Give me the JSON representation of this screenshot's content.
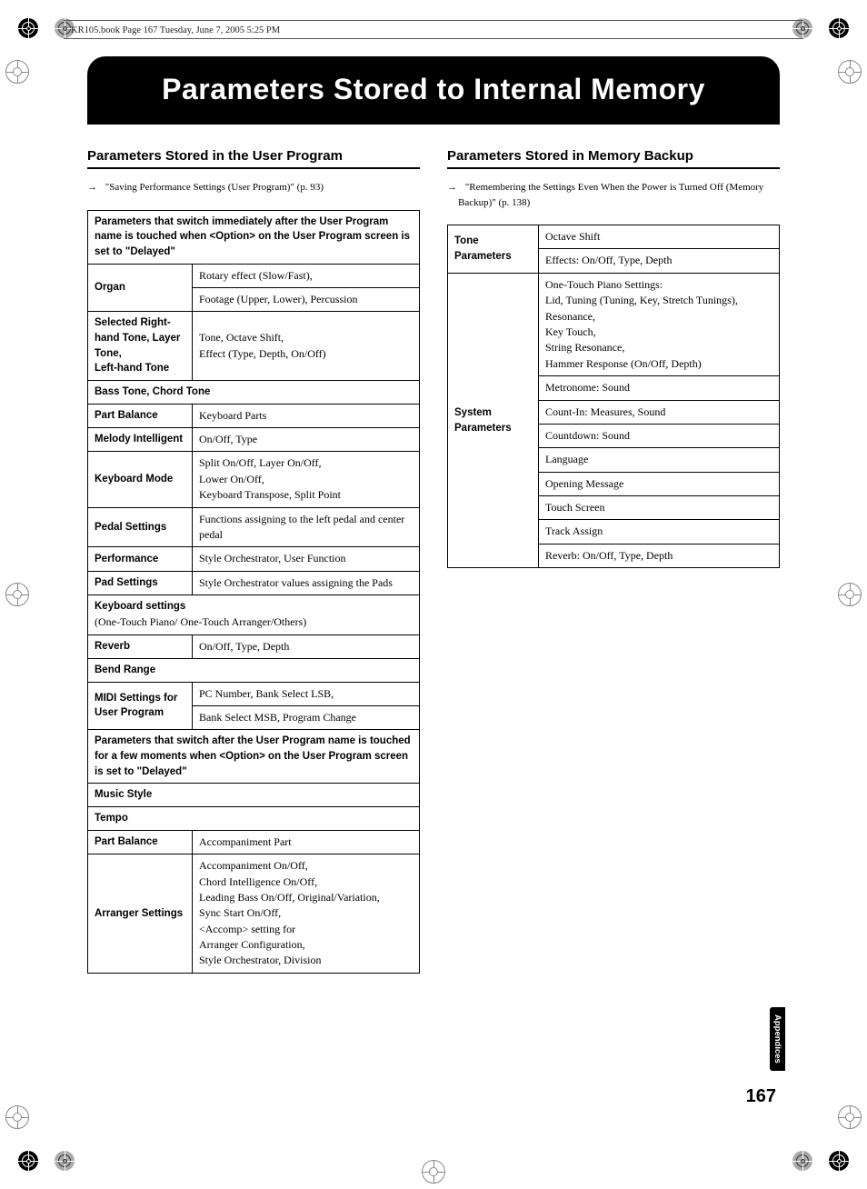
{
  "header_line": "KR105.book  Page 167  Tuesday, June 7, 2005  5:25 PM",
  "title": "Parameters Stored to Internal Memory",
  "left": {
    "heading": "Parameters Stored in the User Program",
    "ref_arrow": "→",
    "ref": "\"Saving Performance Settings (User Program)\" (p. 93)",
    "section1_header": "Parameters that switch immediately after the User Program name is touched when <Option> on the User Program screen is set to \"Delayed\"",
    "rows1": [
      {
        "label": "Organ",
        "value": "Rotary effect (Slow/Fast),\nFootage (Upper, Lower), Percussion",
        "split": true
      },
      {
        "label": "Selected Right-hand Tone, Layer Tone,\nLeft-hand Tone",
        "value": "Tone, Octave Shift,\nEffect (Type, Depth, On/Off)"
      },
      {
        "full": "Bass Tone, Chord Tone"
      },
      {
        "label": "Part Balance",
        "value": "Keyboard Parts"
      },
      {
        "label": "Melody Intelligent",
        "value": "On/Off, Type"
      },
      {
        "label": "Keyboard Mode",
        "value": "Split On/Off, Layer On/Off,\nLower On/Off,\nKeyboard Transpose, Split Point"
      },
      {
        "label": "Pedal Settings",
        "value": "Functions assigning to the left pedal and center pedal"
      },
      {
        "label": "Performance",
        "value": "Style Orchestrator, User Function"
      },
      {
        "label": "Pad Settings",
        "value": "Style Orchestrator values assigning the Pads"
      },
      {
        "full": "Keyboard settings",
        "subnote": "(One-Touch Piano/ One-Touch Arranger/Others)"
      },
      {
        "label": "Reverb",
        "value": "On/Off, Type, Depth"
      },
      {
        "full": "Bend Range"
      },
      {
        "label": "MIDI Settings for User Program",
        "value": "PC Number, Bank Select LSB,\nBank Select MSB, Program Change",
        "split": true
      }
    ],
    "section2_header": "Parameters that switch after the User Program name is touched for a few moments when <Option> on the User Program screen is set to \"Delayed\"",
    "rows2": [
      {
        "full": "Music Style"
      },
      {
        "full": "Tempo"
      },
      {
        "label": "Part Balance",
        "value": "Accompaniment Part"
      },
      {
        "label": "Arranger Settings",
        "value": "Accompaniment On/Off,\nChord Intelligence On/Off,\nLeading Bass On/Off, Original/Variation,\nSync Start On/Off,\n<Accomp> setting for\nArranger Configuration,\nStyle Orchestrator, Division"
      }
    ]
  },
  "right": {
    "heading": "Parameters Stored in Memory Backup",
    "ref_arrow": "→",
    "ref": "\"Remembering the Settings Even When the Power is Turned Off (Memory Backup)\" (p. 138)",
    "tone_label": "Tone Parameters",
    "tone_rows": [
      "Octave Shift",
      "Effects: On/Off, Type, Depth"
    ],
    "system_label": "System Parameters",
    "system_rows": [
      "One-Touch Piano Settings:\nLid, Tuning (Tuning, Key, Stretch Tunings),\nResonance,\nKey Touch,\nString Resonance,\nHammer Response (On/Off, Depth)",
      "Metronome: Sound",
      "Count-In: Measures, Sound",
      "Countdown: Sound",
      "Language",
      "Opening Message",
      "Touch Screen",
      "Track Assign",
      "Reverb: On/Off, Type, Depth"
    ]
  },
  "side_tab": "Appendices",
  "page_number": "167"
}
